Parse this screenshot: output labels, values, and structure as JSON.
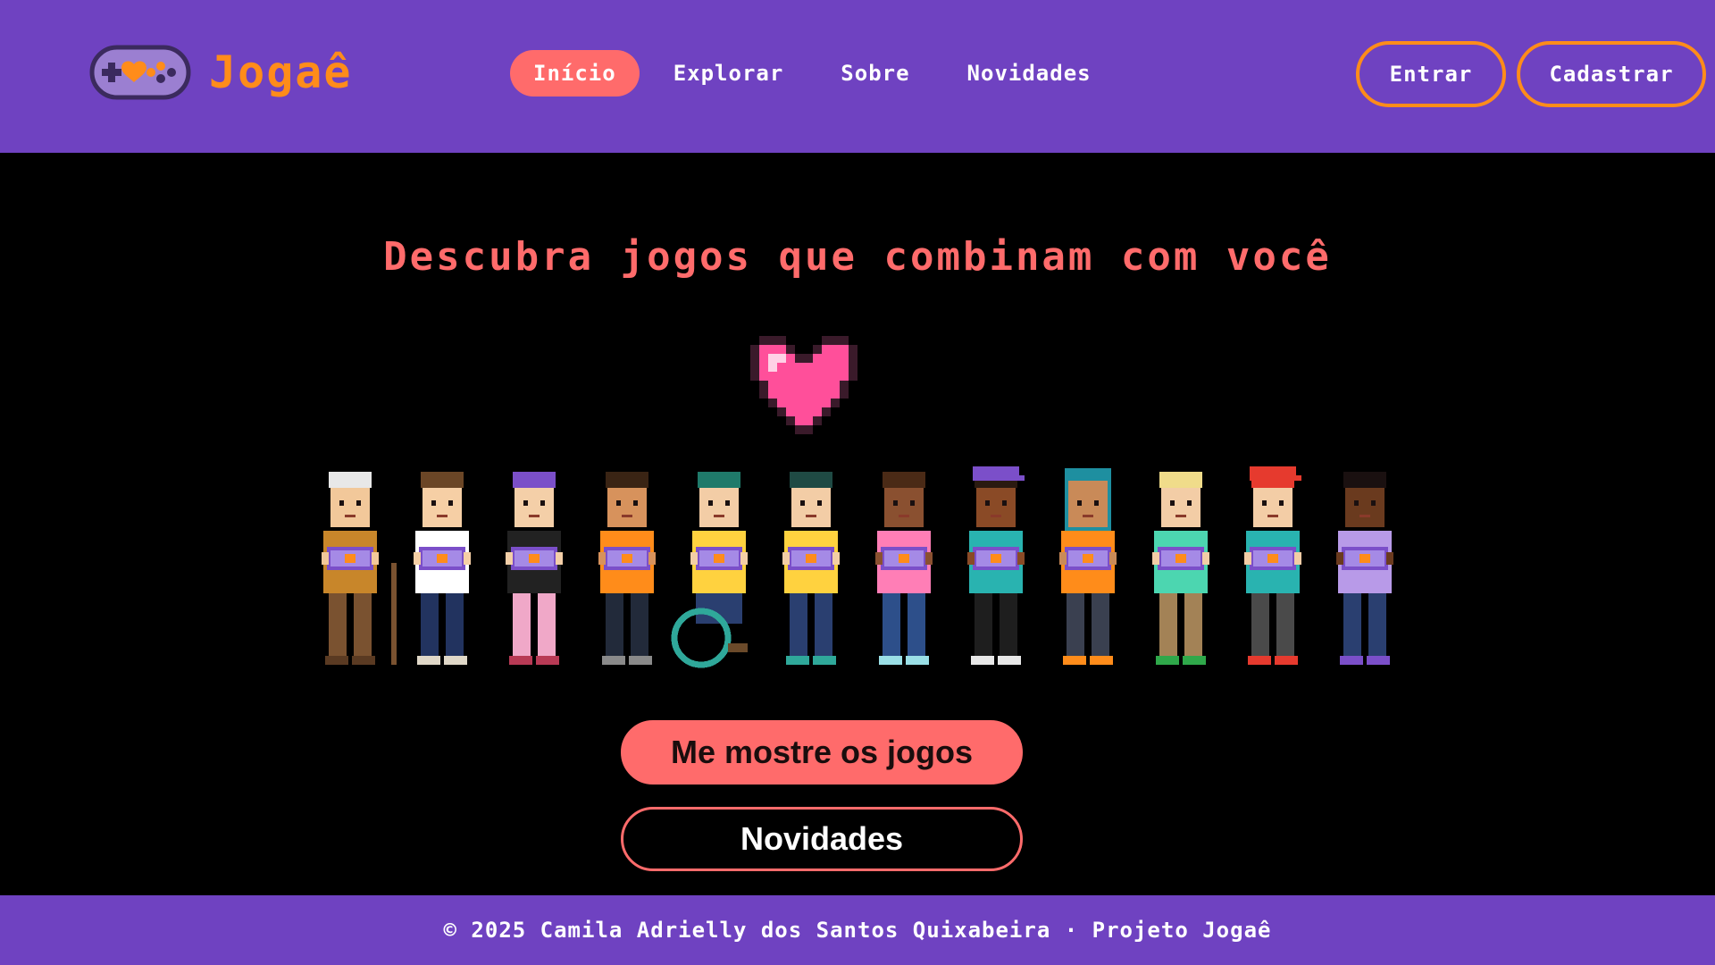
{
  "header": {
    "logo_text": "Jogaê",
    "nav": [
      {
        "label": "Início",
        "active": true
      },
      {
        "label": "Explorar",
        "active": false
      },
      {
        "label": "Sobre",
        "active": false
      },
      {
        "label": "Novidades",
        "active": false
      }
    ],
    "login_label": "Entrar",
    "signup_label": "Cadastrar"
  },
  "hero": {
    "title": "Descubra jogos que combinam com você",
    "primary_cta": "Me mostre os jogos",
    "secondary_cta": "Novidades"
  },
  "footer": {
    "text": "© 2025 Camila Adrielly dos Santos Quixabeira · Projeto Jogaê"
  },
  "colors": {
    "brand_purple": "#6f42c1",
    "accent_coral": "#ff6b6b",
    "accent_orange": "#ff8c1a",
    "background": "#000000"
  },
  "icons": [
    "gamepad-heart-icon",
    "pixel-heart-icon"
  ],
  "illustration": {
    "characters": [
      {
        "skin": "#f2c89a",
        "hair": "#e8e8e8",
        "shirt": "#c8862a",
        "pants": "#7a5230",
        "shoes": "#5a3a22"
      },
      {
        "skin": "#f6cfa5",
        "hair": "#6b4626",
        "shirt": "#ffffff",
        "pants": "#22335f",
        "shoes": "#e0d8c8"
      },
      {
        "skin": "#f4cfa8",
        "hair": "#7b4fc9",
        "shirt": "#222222",
        "pants": "#f0a8c8",
        "shoes": "#b83a55"
      },
      {
        "skin": "#d7925c",
        "hair": "#3a2414",
        "shirt": "#ff8c1a",
        "pants": "#222a3a",
        "shoes": "#8a8a8a"
      },
      {
        "skin": "#f3cda6",
        "hair": "#1f7a6a",
        "shirt": "#ffd23f",
        "pants": "#2a3f70",
        "shoes": "#6b4a2a",
        "wheelchair": true
      },
      {
        "skin": "#f3cda6",
        "hair": "#1f4a44",
        "shirt": "#ffd23f",
        "pants": "#2a3f70",
        "shoes": "#2fa89a"
      },
      {
        "skin": "#8a5030",
        "hair": "#4a2a16",
        "shirt": "#ff7eb6",
        "pants": "#2d4f8a",
        "shoes": "#9adfe6"
      },
      {
        "skin": "#8a4a26",
        "hair": "#2a1a10",
        "shirt": "#29b3b0",
        "pants": "#1e1e1e",
        "shoes": "#e8e8e8",
        "cap": "#7b4fc9"
      },
      {
        "skin": "#c98a58",
        "hair": "#1e8fa0",
        "shirt": "#ff8c1a",
        "pants": "#3a4050",
        "shoes": "#ff8c1a",
        "hijab": true
      },
      {
        "skin": "#f3cda6",
        "hair": "#f0dc8a",
        "shirt": "#4cd6b0",
        "pants": "#a38256",
        "shoes": "#2fa84a"
      },
      {
        "skin": "#f3cda6",
        "hair": "#e63a2e",
        "shirt": "#29b3b0",
        "pants": "#4a4a4a",
        "shoes": "#e63a2e",
        "cap": "#e63a2e"
      },
      {
        "skin": "#6a3a1e",
        "hair": "#1a1010",
        "shirt": "#b89ae8",
        "pants": "#2a3f70",
        "shoes": "#7b4fc9"
      }
    ]
  }
}
